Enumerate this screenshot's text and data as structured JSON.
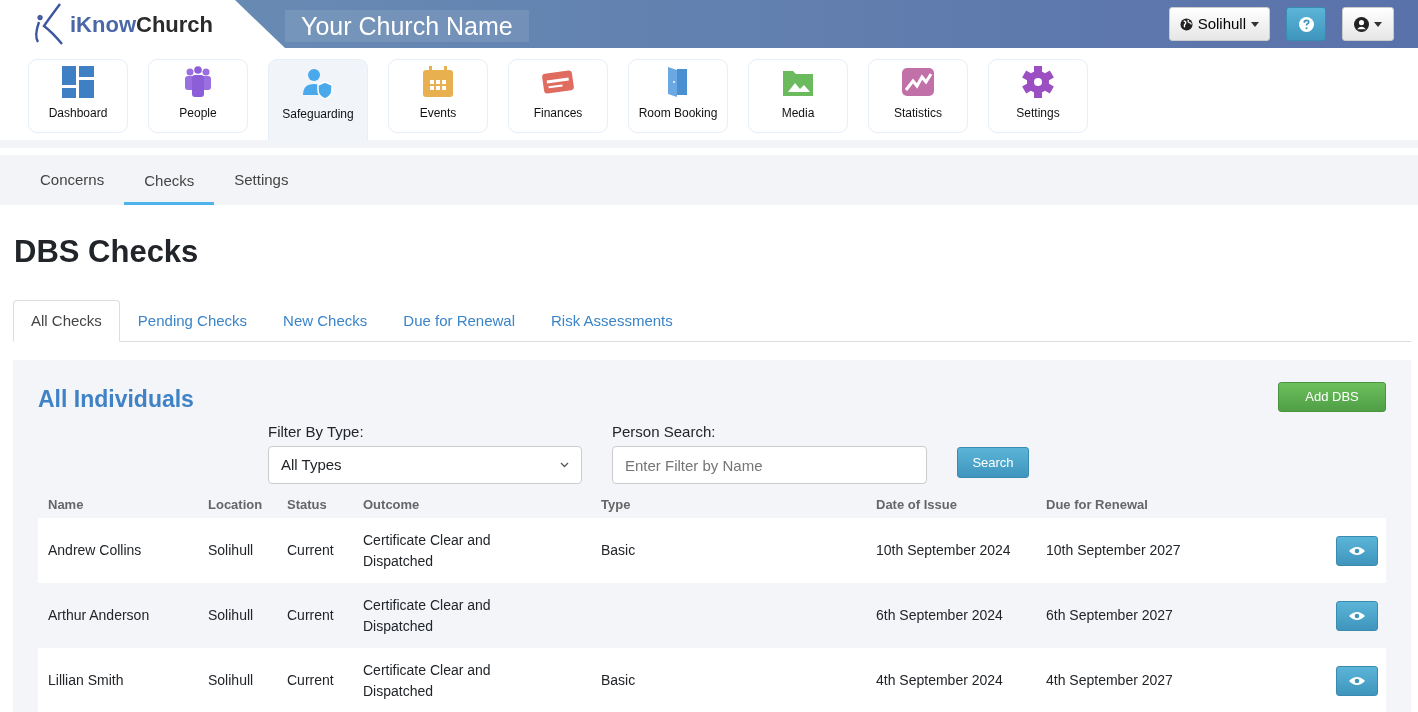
{
  "header": {
    "brand": "iKnowChurch",
    "church_name": "Your Church Name",
    "location_button": "Solihull"
  },
  "modules": [
    {
      "label": "Dashboard",
      "selected": false
    },
    {
      "label": "People",
      "selected": false
    },
    {
      "label": "Safeguarding",
      "selected": true
    },
    {
      "label": "Events",
      "selected": false
    },
    {
      "label": "Finances",
      "selected": false
    },
    {
      "label": "Room Booking",
      "selected": false
    },
    {
      "label": "Media",
      "selected": false
    },
    {
      "label": "Statistics",
      "selected": false
    },
    {
      "label": "Settings",
      "selected": false
    }
  ],
  "subnav": [
    {
      "label": "Concerns",
      "selected": false
    },
    {
      "label": "Checks",
      "selected": true
    },
    {
      "label": "Settings",
      "selected": false
    }
  ],
  "page_title": "DBS Checks",
  "tabs": [
    {
      "label": "All Checks",
      "selected": true
    },
    {
      "label": "Pending Checks",
      "selected": false
    },
    {
      "label": "New Checks",
      "selected": false
    },
    {
      "label": "Due for Renewal",
      "selected": false
    },
    {
      "label": "Risk Assessments",
      "selected": false
    }
  ],
  "panel": {
    "title": "All Individuals",
    "add_button": "Add DBS",
    "filter": {
      "label": "Filter By Type:",
      "value": "All Types"
    },
    "search": {
      "label": "Person Search:",
      "placeholder": "Enter Filter by Name",
      "button": "Search"
    }
  },
  "table": {
    "columns": [
      "Name",
      "Location",
      "Status",
      "Outcome",
      "Type",
      "Date of Issue",
      "Due for Renewal"
    ],
    "rows": [
      [
        "Andrew Collins",
        "Solihull",
        "Current",
        "Certificate Clear and Dispatched",
        "Basic",
        "10th September 2024",
        "10th September 2027"
      ],
      [
        "Arthur Anderson",
        "Solihull",
        "Current",
        "Certificate Clear and Dispatched",
        "",
        "6th September 2024",
        "6th September 2027"
      ],
      [
        "Lillian Smith",
        "Solihull",
        "Current",
        "Certificate Clear and Dispatched",
        "Basic",
        "4th September 2024",
        "4th September 2027"
      ]
    ]
  }
}
